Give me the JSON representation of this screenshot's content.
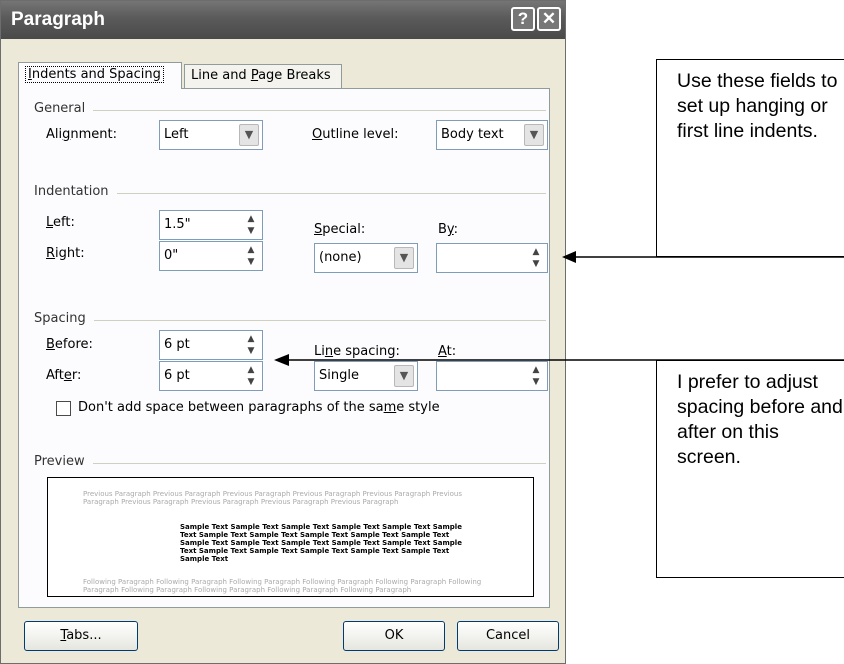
{
  "dialog": {
    "title": "Paragraph",
    "help_glyph": "?",
    "close_glyph": "✕",
    "tabs": [
      {
        "pre": "",
        "u": "I",
        "post": "ndents and Spacing"
      },
      {
        "pre": "Line and ",
        "u": "P",
        "post": "age Breaks"
      }
    ],
    "general": {
      "group_label": "General",
      "alignment_pre": "Ali",
      "alignment_u": "g",
      "alignment_post": "nment:",
      "alignment_value": "Left",
      "outline_u": "O",
      "outline_post": "utline level:",
      "outline_value": "Body text"
    },
    "indentation": {
      "group_label": "Indentation",
      "left_u": "L",
      "left_post": "eft:",
      "left_value": "1.5\"",
      "right_u": "R",
      "right_post": "ight:",
      "right_value": "0\"",
      "special_u": "S",
      "special_post": "pecial:",
      "special_value": "(none)",
      "by_pre": "B",
      "by_u": "y",
      "by_post": ":",
      "by_value": ""
    },
    "spacing": {
      "group_label": "Spacing",
      "before_u": "B",
      "before_post": "efore:",
      "before_value": "6 pt",
      "after_pre": "Aft",
      "after_u": "e",
      "after_post": "r:",
      "after_value": "6 pt",
      "line_pre": "Li",
      "line_u": "n",
      "line_post": "e spacing:",
      "line_value": "Single",
      "at_u": "A",
      "at_post": "t:",
      "at_value": "",
      "checkbox_pre": "Don't add space between paragraphs of the sa",
      "checkbox_u": "m",
      "checkbox_post": "e style"
    },
    "preview": {
      "group_label": "Preview",
      "previous_text": "Previous Paragraph Previous Paragraph Previous Paragraph Previous Paragraph Previous Paragraph Previous Paragraph Previous Paragraph Previous Paragraph Previous Paragraph Previous Paragraph",
      "sample_text": "Sample Text Sample Text Sample Text Sample Text Sample Text Sample Text Sample Text Sample Text Sample Text Sample Text Sample Text Sample Text Sample Text Sample Text Sample Text Sample Text Sample Text Sample Text Sample Text Sample Text Sample Text Sample Text Sample Text",
      "following_text": "Following Paragraph Following Paragraph Following Paragraph Following Paragraph Following Paragraph Following Paragraph Following Paragraph Following Paragraph Following Paragraph Following Paragraph"
    },
    "buttons": {
      "tabs_u": "T",
      "tabs_post": "abs...",
      "ok": "OK",
      "cancel": "Cancel"
    }
  },
  "callouts": {
    "first": "Use these fields to set up hanging or first line indents.",
    "second": "I prefer to adjust spacing before and after on this screen."
  },
  "colors": {
    "dialog_bg": "#ece9d8",
    "titlebar": "#5a5a5a",
    "panel_bg": "#fcfcfe",
    "field_border": "#7f9db9"
  }
}
